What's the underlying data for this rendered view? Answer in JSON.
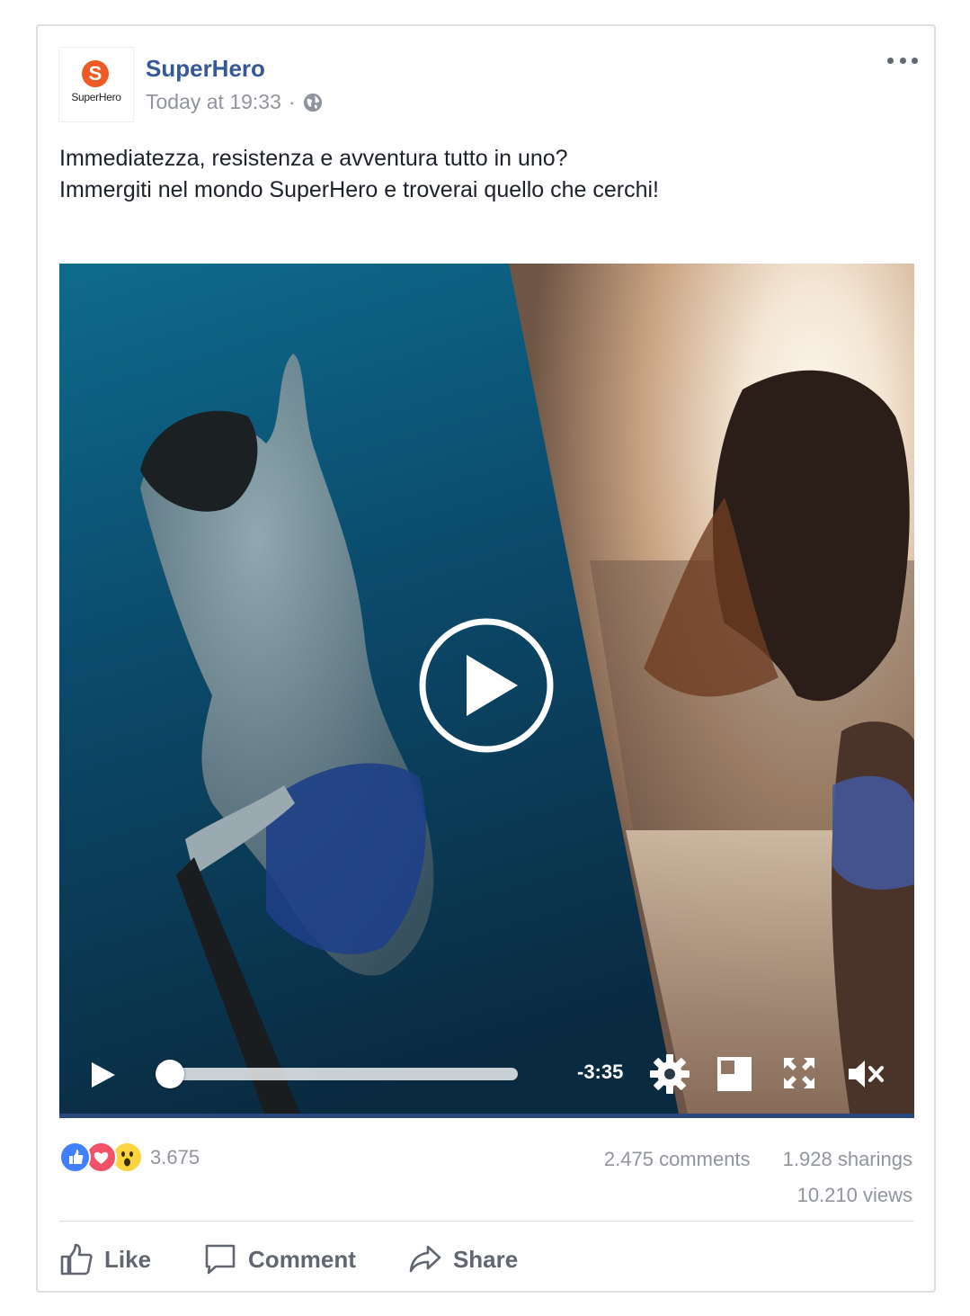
{
  "post": {
    "page_name": "SuperHero",
    "logo_text": "SuperHero",
    "timestamp": "Today at 19:33",
    "meta_separator": "·",
    "text_lines": [
      "Immediatezza, resistenza e avventura tutto in uno?",
      "Immergiti nel mondo SuperHero e troverai quello che cerchi!"
    ]
  },
  "video": {
    "time_remaining": "-3:35",
    "progress": 0.0
  },
  "engagement": {
    "reactions": [
      "like-icon",
      "love-icon",
      "wow-icon"
    ],
    "reaction_count": "3.675",
    "comments": "2.475 comments",
    "shares": "1.928 sharings",
    "views": "10.210 views"
  },
  "actions": {
    "like": "Like",
    "comment": "Comment",
    "share": "Share"
  },
  "colors": {
    "page_name": "#365899",
    "secondary_text": "#90949c",
    "brand_orange": "#ee5a24",
    "like_blue": "#4080ff",
    "love_red": "#f25268",
    "wow_yellow": "#fcd440"
  }
}
